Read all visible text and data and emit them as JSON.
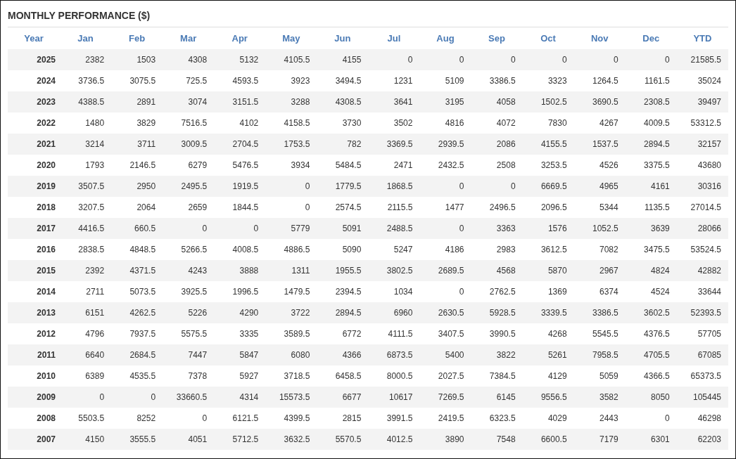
{
  "title": "MONTHLY PERFORMANCE ($)",
  "table": {
    "columns": [
      "Year",
      "Jan",
      "Feb",
      "Mar",
      "Apr",
      "May",
      "Jun",
      "Jul",
      "Aug",
      "Sep",
      "Oct",
      "Nov",
      "Dec",
      "YTD"
    ],
    "rows": [
      [
        "2025",
        "2382",
        "1503",
        "4308",
        "5132",
        "4105.5",
        "4155",
        "0",
        "0",
        "0",
        "0",
        "0",
        "0",
        "21585.5"
      ],
      [
        "2024",
        "3736.5",
        "3075.5",
        "725.5",
        "4593.5",
        "3923",
        "3494.5",
        "1231",
        "5109",
        "3386.5",
        "3323",
        "1264.5",
        "1161.5",
        "35024"
      ],
      [
        "2023",
        "4388.5",
        "2891",
        "3074",
        "3151.5",
        "3288",
        "4308.5",
        "3641",
        "3195",
        "4058",
        "1502.5",
        "3690.5",
        "2308.5",
        "39497"
      ],
      [
        "2022",
        "1480",
        "3829",
        "7516.5",
        "4102",
        "4158.5",
        "3730",
        "3502",
        "4816",
        "4072",
        "7830",
        "4267",
        "4009.5",
        "53312.5"
      ],
      [
        "2021",
        "3214",
        "3711",
        "3009.5",
        "2704.5",
        "1753.5",
        "782",
        "3369.5",
        "2939.5",
        "2086",
        "4155.5",
        "1537.5",
        "2894.5",
        "32157"
      ],
      [
        "2020",
        "1793",
        "2146.5",
        "6279",
        "5476.5",
        "3934",
        "5484.5",
        "2471",
        "2432.5",
        "2508",
        "3253.5",
        "4526",
        "3375.5",
        "43680"
      ],
      [
        "2019",
        "3507.5",
        "2950",
        "2495.5",
        "1919.5",
        "0",
        "1779.5",
        "1868.5",
        "0",
        "0",
        "6669.5",
        "4965",
        "4161",
        "30316"
      ],
      [
        "2018",
        "3207.5",
        "2064",
        "2659",
        "1844.5",
        "0",
        "2574.5",
        "2115.5",
        "1477",
        "2496.5",
        "2096.5",
        "5344",
        "1135.5",
        "27014.5"
      ],
      [
        "2017",
        "4416.5",
        "660.5",
        "0",
        "0",
        "5779",
        "5091",
        "2488.5",
        "0",
        "3363",
        "1576",
        "1052.5",
        "3639",
        "28066"
      ],
      [
        "2016",
        "2838.5",
        "4848.5",
        "5266.5",
        "4008.5",
        "4886.5",
        "5090",
        "5247",
        "4186",
        "2983",
        "3612.5",
        "7082",
        "3475.5",
        "53524.5"
      ],
      [
        "2015",
        "2392",
        "4371.5",
        "4243",
        "3888",
        "1311",
        "1955.5",
        "3802.5",
        "2689.5",
        "4568",
        "5870",
        "2967",
        "4824",
        "42882"
      ],
      [
        "2014",
        "2711",
        "5073.5",
        "3925.5",
        "1996.5",
        "1479.5",
        "2394.5",
        "1034",
        "0",
        "2762.5",
        "1369",
        "6374",
        "4524",
        "33644"
      ],
      [
        "2013",
        "6151",
        "4262.5",
        "5226",
        "4290",
        "3722",
        "2894.5",
        "6960",
        "2630.5",
        "5928.5",
        "3339.5",
        "3386.5",
        "3602.5",
        "52393.5"
      ],
      [
        "2012",
        "4796",
        "7937.5",
        "5575.5",
        "3335",
        "3589.5",
        "6772",
        "4111.5",
        "3407.5",
        "3990.5",
        "4268",
        "5545.5",
        "4376.5",
        "57705"
      ],
      [
        "2011",
        "6640",
        "2684.5",
        "7447",
        "5847",
        "6080",
        "4366",
        "6873.5",
        "5400",
        "3822",
        "5261",
        "7958.5",
        "4705.5",
        "67085"
      ],
      [
        "2010",
        "6389",
        "4535.5",
        "7378",
        "5927",
        "3718.5",
        "6458.5",
        "8000.5",
        "2027.5",
        "7384.5",
        "4129",
        "5059",
        "4366.5",
        "65373.5"
      ],
      [
        "2009",
        "0",
        "0",
        "33660.5",
        "4314",
        "15573.5",
        "6677",
        "10617",
        "7269.5",
        "6145",
        "9556.5",
        "3582",
        "8050",
        "105445"
      ],
      [
        "2008",
        "5503.5",
        "8252",
        "0",
        "6121.5",
        "4399.5",
        "2815",
        "3991.5",
        "2419.5",
        "6323.5",
        "4029",
        "2443",
        "0",
        "46298"
      ],
      [
        "2007",
        "4150",
        "3555.5",
        "4051",
        "5712.5",
        "3632.5",
        "5570.5",
        "4012.5",
        "3890",
        "7548",
        "6600.5",
        "7179",
        "6301",
        "62203"
      ]
    ]
  }
}
